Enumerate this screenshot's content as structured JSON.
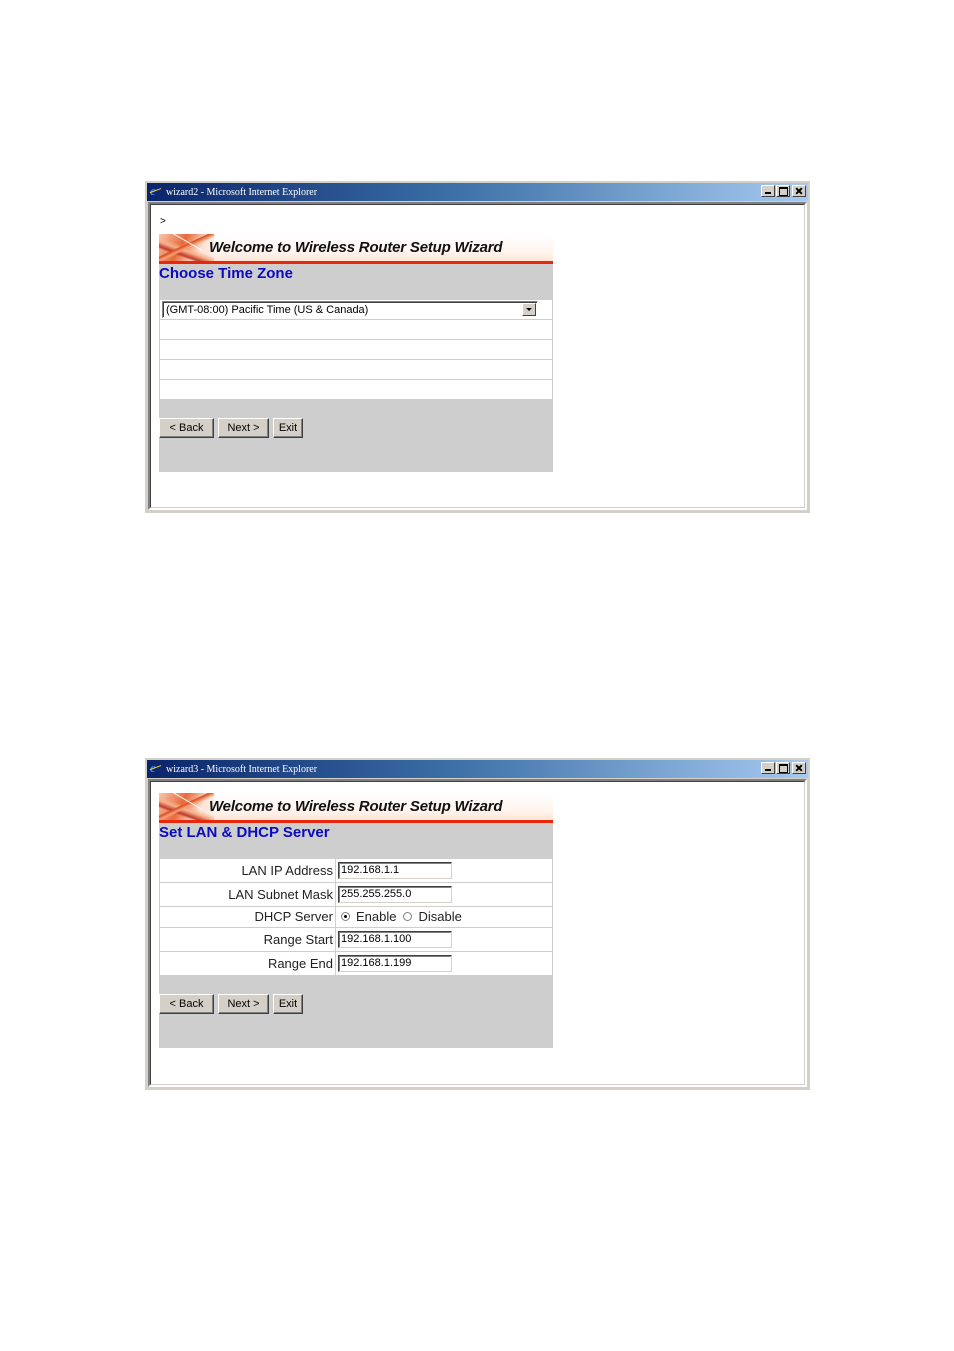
{
  "windows": [
    {
      "title": "wizard2 - Microsoft Internet Explorer",
      "stray_text": ">",
      "banner_title": "Welcome to Wireless Router Setup Wizard",
      "section_title": "Choose Time Zone",
      "time_zone": {
        "selected": "(GMT-08:00) Pacific Time (US & Canada)"
      },
      "buttons": {
        "back": "< Back",
        "next": "Next >",
        "exit": "Exit"
      }
    },
    {
      "title": "wizard3 - Microsoft Internet Explorer",
      "banner_title": "Welcome to Wireless Router Setup Wizard",
      "section_title": "Set LAN & DHCP Server",
      "fields": {
        "lan_ip": {
          "label": "LAN IP Address",
          "value": "192.168.1.1"
        },
        "subnet": {
          "label": "LAN Subnet Mask",
          "value": "255.255.255.0"
        },
        "dhcp": {
          "label": "DHCP Server",
          "options": [
            "Enable",
            "Disable"
          ],
          "selected": "Enable"
        },
        "range_start": {
          "label": "Range Start",
          "value": "192.168.1.100"
        },
        "range_end": {
          "label": "Range End",
          "value": "192.168.1.199"
        }
      },
      "buttons": {
        "back": "< Back",
        "next": "Next >",
        "exit": "Exit"
      }
    }
  ],
  "colors": {
    "section_title": "#0b0bbf",
    "panel_bg": "#cecece",
    "banner_accent": "#e8280c",
    "titlebar_start": "#0a246a",
    "titlebar_end": "#a6caf0"
  }
}
